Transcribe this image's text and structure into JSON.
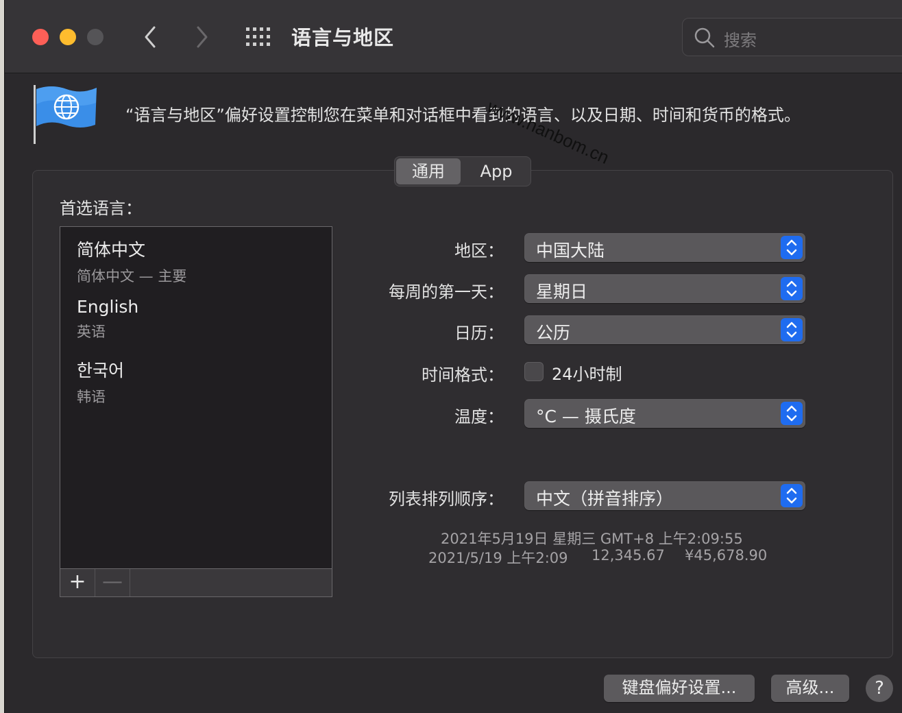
{
  "window": {
    "title": "语言与地区"
  },
  "search": {
    "placeholder": "搜索"
  },
  "header": {
    "description": "“语言与地区”偏好设置控制您在菜单和对话框中看到的语言、以及日期、时间和货币的格式。"
  },
  "watermark": "www.hanbom.cn",
  "tabs": [
    {
      "label": "通用",
      "selected": true
    },
    {
      "label": "App",
      "selected": false
    }
  ],
  "preferred_languages": {
    "title": "首选语言：",
    "items": [
      {
        "name": "简体中文",
        "sub": "简体中文 — 主要"
      },
      {
        "name": "English",
        "sub": "英语"
      },
      {
        "name": "한국어",
        "sub": "韩语"
      }
    ],
    "add_label": "+",
    "remove_label": "—"
  },
  "settings": {
    "region": {
      "label": "地区：",
      "value": "中国大陆"
    },
    "first_day": {
      "label": "每周的第一天：",
      "value": "星期日"
    },
    "calendar": {
      "label": "日历：",
      "value": "公历"
    },
    "time_format": {
      "label": "时间格式：",
      "checkbox_label": "24小时制",
      "checked": false
    },
    "temperature": {
      "label": "温度：",
      "value": "°C — 摄氏度"
    },
    "list_sort": {
      "label": "列表排列顺序：",
      "value": "中文（拼音排序）"
    }
  },
  "samples": {
    "line1": "2021年5月19日 星期三 GMT+8 上午2:09:55",
    "short_date": "2021/5/19 上午2:09",
    "number": "12,345.67",
    "currency": "¥45,678.90"
  },
  "buttons": {
    "keyboard": "键盘偏好设置...",
    "advanced": "高级...",
    "help": "?"
  },
  "colors": {
    "close": "#fe5f57",
    "minimize": "#febc2e",
    "accent": "#1f6cf0"
  }
}
